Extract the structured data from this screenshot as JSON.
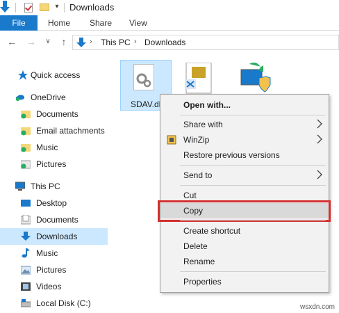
{
  "window": {
    "title": "Downloads"
  },
  "ribbon": {
    "tabs": [
      "File",
      "Home",
      "Share",
      "View"
    ]
  },
  "address": {
    "crumbs": [
      "This PC",
      "Downloads"
    ]
  },
  "sidebar": {
    "items": [
      {
        "label": "Quick access"
      },
      {
        "label": "OneDrive"
      },
      {
        "label": "Documents"
      },
      {
        "label": "Email attachments"
      },
      {
        "label": "Music"
      },
      {
        "label": "Pictures"
      },
      {
        "label": "This PC"
      },
      {
        "label": "Desktop"
      },
      {
        "label": "Documents"
      },
      {
        "label": "Downloads"
      },
      {
        "label": "Music"
      },
      {
        "label": "Pictures"
      },
      {
        "label": "Videos"
      },
      {
        "label": "Local Disk (C:)"
      }
    ]
  },
  "files": {
    "selected_name": "SDAV.dll"
  },
  "context_menu": {
    "items": [
      {
        "label": "Open with..."
      },
      {
        "label": "Share with"
      },
      {
        "label": "WinZip"
      },
      {
        "label": "Restore previous versions"
      },
      {
        "label": "Send to"
      },
      {
        "label": "Cut"
      },
      {
        "label": "Copy"
      },
      {
        "label": "Create shortcut"
      },
      {
        "label": "Delete"
      },
      {
        "label": "Rename"
      },
      {
        "label": "Properties"
      }
    ]
  },
  "watermark": "wsxdn.com",
  "colors": {
    "accent": "#1979ca",
    "selection": "#cce8ff",
    "highlight_border": "#d32f2f"
  }
}
